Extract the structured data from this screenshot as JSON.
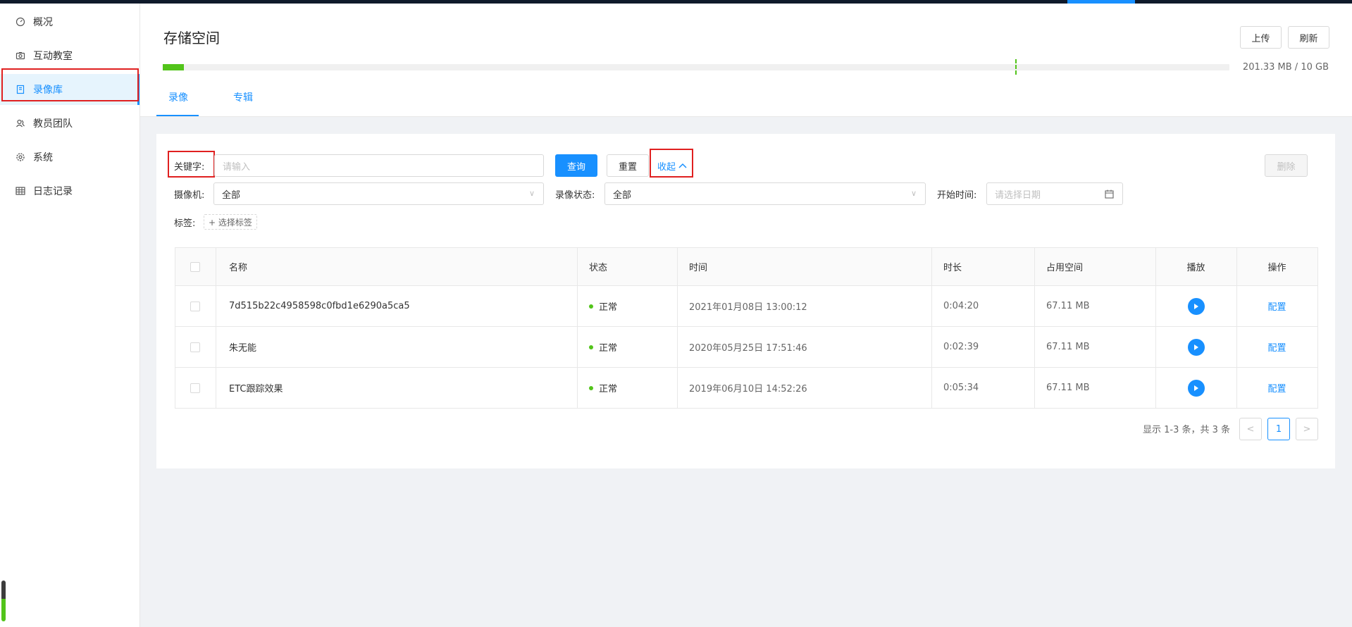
{
  "sidebar": {
    "items": [
      {
        "label": "概况",
        "icon": "dashboard-icon"
      },
      {
        "label": "互动教室",
        "icon": "camera-icon"
      },
      {
        "label": "录像库",
        "icon": "book-icon",
        "active": true
      },
      {
        "label": "教员团队",
        "icon": "team-icon"
      },
      {
        "label": "系统",
        "icon": "settings-icon"
      },
      {
        "label": "日志记录",
        "icon": "table-icon"
      }
    ]
  },
  "header": {
    "title": "存储空间",
    "upload_label": "上传",
    "refresh_label": "刷新",
    "storage": {
      "used_text": "201.33 MB / 10 GB",
      "used_fraction": 0.02
    }
  },
  "tabs": [
    {
      "label": "录像",
      "active": true
    },
    {
      "label": "专辑",
      "active": false
    }
  ],
  "filters": {
    "keyword_label": "关键字:",
    "keyword_placeholder": "请输入",
    "search_label": "查询",
    "reset_label": "重置",
    "collapse_label": "收起",
    "delete_label": "删除",
    "camera_label": "摄像机:",
    "camera_value": "全部",
    "status_label": "录像状态:",
    "status_value": "全部",
    "start_time_label": "开始时间:",
    "start_time_placeholder": "请选择日期",
    "tag_label": "标签:",
    "tag_add_label": "+ 选择标签"
  },
  "table": {
    "columns": [
      "名称",
      "状态",
      "时间",
      "时长",
      "占用空间",
      "播放",
      "操作"
    ],
    "rows": [
      {
        "name": "7d515b22c4958598c0fbd1e6290a5ca5",
        "status": "正常",
        "time": "2021年01月08日 13:00:12",
        "duration": "0:04:20",
        "size": "67.11 MB",
        "action": "配置"
      },
      {
        "name": "朱无能",
        "status": "正常",
        "time": "2020年05月25日 17:51:46",
        "duration": "0:02:39",
        "size": "67.11 MB",
        "action": "配置"
      },
      {
        "name": "ETC跟踪效果",
        "status": "正常",
        "time": "2019年06月10日 14:52:26",
        "duration": "0:05:34",
        "size": "67.11 MB",
        "action": "配置"
      }
    ]
  },
  "pagination": {
    "summary": "显示 1-3 条，共 3 条",
    "current_page": "1"
  },
  "colors": {
    "accent": "#1890ff",
    "success": "#52c41a",
    "highlight": "#e02020"
  }
}
